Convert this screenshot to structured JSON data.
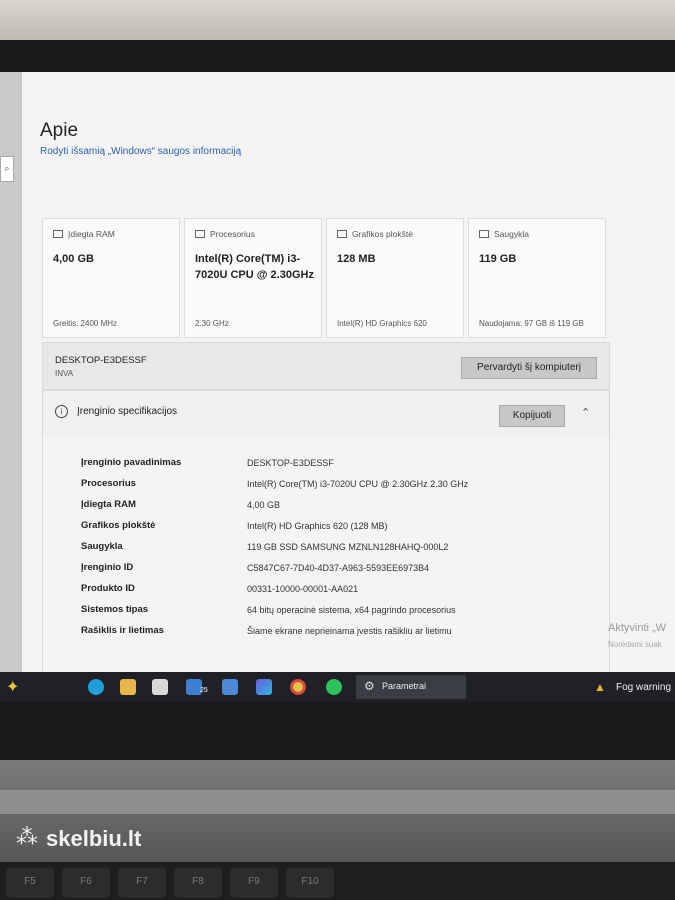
{
  "window": {
    "title": "Apie",
    "security_link": "Rodyti išsamią „Windows“ saugos informaciją"
  },
  "cards": [
    {
      "label": "Įdiegta RAM",
      "value": "4,00 GB",
      "footer": "Greitis: 2400 MHz",
      "icon": "ram-icon"
    },
    {
      "label": "Procesorius",
      "value": "Intel(R) Core(TM) i3-7020U CPU @ 2.30GHz",
      "footer": "2.30 GHz",
      "icon": "cpu-icon"
    },
    {
      "label": "Grafikos plokštė",
      "value": "128 MB",
      "footer": "Intel(R) HD Graphics 620",
      "icon": "gpu-icon"
    },
    {
      "label": "Saugykla",
      "value": "119 GB",
      "footer": "Naudojama: 97 GB iš 119 GB",
      "icon": "storage-icon"
    }
  ],
  "device": {
    "name": "DESKTOP-E3DESSF",
    "owner": "INVA",
    "rename_button": "Pervardyti šį kompiuterį"
  },
  "specs": {
    "title": "Įrenginio specifikacijos",
    "copy_button": "Kopijuoti",
    "rows": [
      {
        "key": "Įrenginio pavadinimas",
        "value": "DESKTOP-E3DESSF"
      },
      {
        "key": "Procesorius",
        "value": "Intel(R) Core(TM) i3-7020U CPU @ 2.30GHz   2.30 GHz"
      },
      {
        "key": "Įdiegta RAM",
        "value": "4,00 GB"
      },
      {
        "key": "Grafikos plokštė",
        "value": "Intel(R) HD Graphics 620 (128 MB)"
      },
      {
        "key": "Saugykla",
        "value": "119 GB SSD SAMSUNG MZNLN128HAHQ-000L2"
      },
      {
        "key": "Įrenginio ID",
        "value": "C5847C67-7D40-4D37-A963-5593EE6973B4"
      },
      {
        "key": "Produkto ID",
        "value": "00331-10000-00001-AA021"
      },
      {
        "key": "Sistemos tipas",
        "value": "64 bitų operacinė sistema, x64 pagrindo procesorius"
      },
      {
        "key": "Rašiklis ir lietimas",
        "value": "Šiame ekrane neprieinama įvestis rašikliu ar lietimu"
      }
    ]
  },
  "activation": {
    "line1": "Aktyvinti „W",
    "line2": "Norėdami suak"
  },
  "taskbar": {
    "mail_badge": "25",
    "active_app": "Parametrai",
    "weather": "Fog warning",
    "icons": [
      "edge-icon",
      "file-explorer-icon",
      "store-icon",
      "mail-icon",
      "calculator-icon",
      "copilot-icon",
      "chrome-icon",
      "spotify-icon"
    ]
  },
  "watermark": {
    "text": "skelbiu.lt"
  },
  "keyboard": {
    "keys": [
      "F5",
      "F6",
      "F7",
      "F8",
      "F9",
      "F10"
    ]
  }
}
